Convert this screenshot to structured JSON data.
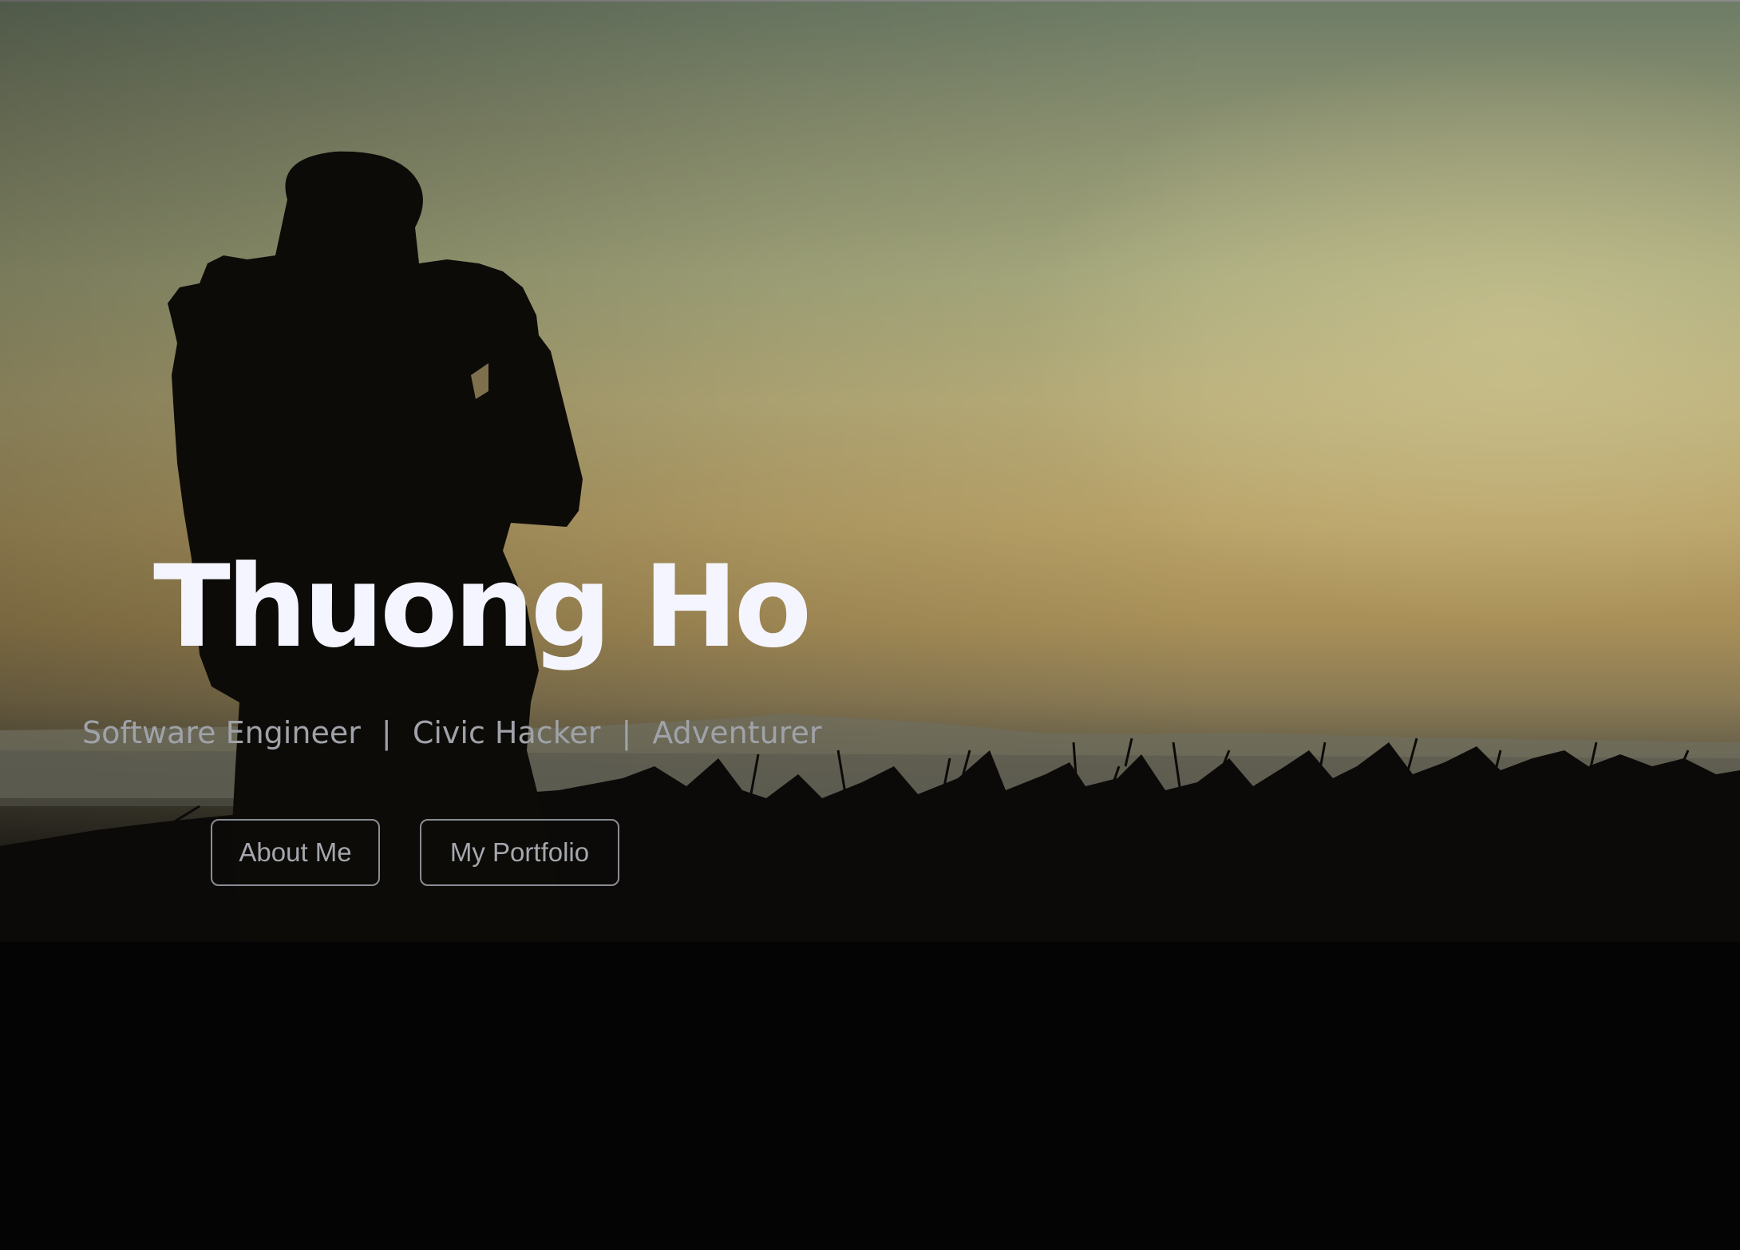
{
  "hero": {
    "name": "Thuong Ho",
    "roles": [
      "Software Engineer",
      "Civic Hacker",
      "Adventurer"
    ],
    "separator": "|",
    "buttons": {
      "about": "About Me",
      "portfolio": "My Portfolio"
    }
  }
}
